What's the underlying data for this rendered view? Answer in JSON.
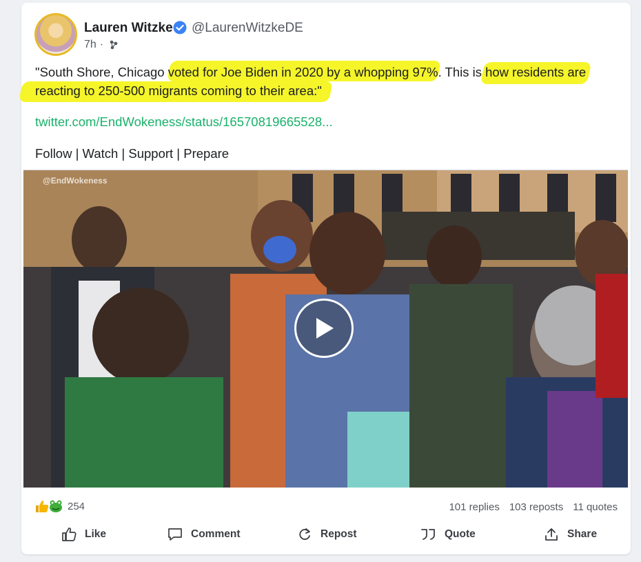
{
  "author": {
    "name": "Lauren Witzke",
    "handle": "@LaurenWitzkeDE",
    "time": "7h",
    "separator": "·"
  },
  "post": {
    "text": "\"South Shore, Chicago voted for Joe Biden in 2020 by a whopping 97%. This is how residents are reacting to 250-500 migrants coming to their area:\"",
    "link": "twitter.com/EndWokeness/status/16570819665528...",
    "footer": "Follow | Watch | Support | Prepare"
  },
  "video": {
    "watermark": "@EndWokeness"
  },
  "stats": {
    "reactions": "254",
    "replies": "101 replies",
    "reposts": "103 reposts",
    "quotes": "11 quotes"
  },
  "actions": {
    "like": "Like",
    "comment": "Comment",
    "repost": "Repost",
    "quote": "Quote",
    "share": "Share"
  },
  "colors": {
    "highlight": "#f5f52a",
    "link": "#1ab26b",
    "verified": "#3b82f6"
  }
}
